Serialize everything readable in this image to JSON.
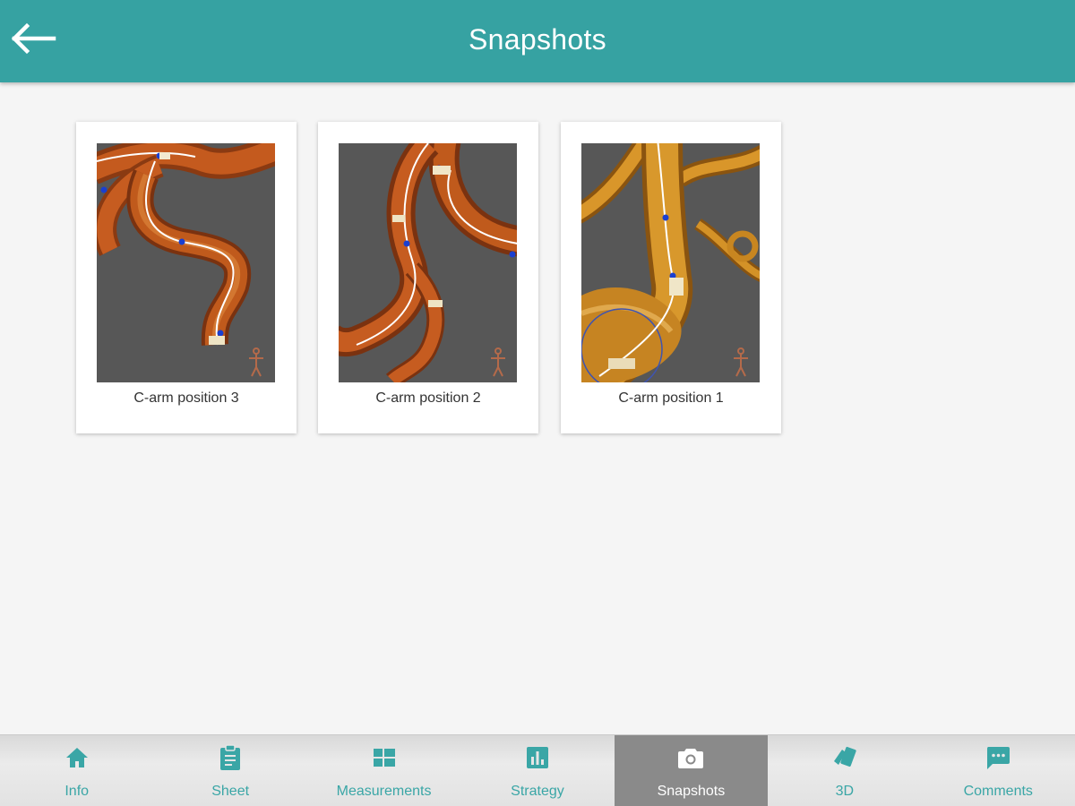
{
  "header": {
    "title": "Snapshots",
    "back_icon": "arrow-left-icon"
  },
  "colors": {
    "accent": "#36a2a2",
    "nav_text": "#3aa6a6",
    "active_tab_bg": "#8a8a8a"
  },
  "snapshots": [
    {
      "caption": "C-arm position 3"
    },
    {
      "caption": "C-arm position 2"
    },
    {
      "caption": "C-arm position 1"
    }
  ],
  "bottom_nav": {
    "active": "Snapshots",
    "items": [
      {
        "label": "Info",
        "icon": "home-icon"
      },
      {
        "label": "Sheet",
        "icon": "clipboard-icon"
      },
      {
        "label": "Measurements",
        "icon": "dashboard-grid-icon"
      },
      {
        "label": "Strategy",
        "icon": "bar-chart-icon"
      },
      {
        "label": "Snapshots",
        "icon": "camera-icon"
      },
      {
        "label": "3D",
        "icon": "cards-icon"
      },
      {
        "label": "Comments",
        "icon": "chat-bubble-icon"
      }
    ]
  }
}
